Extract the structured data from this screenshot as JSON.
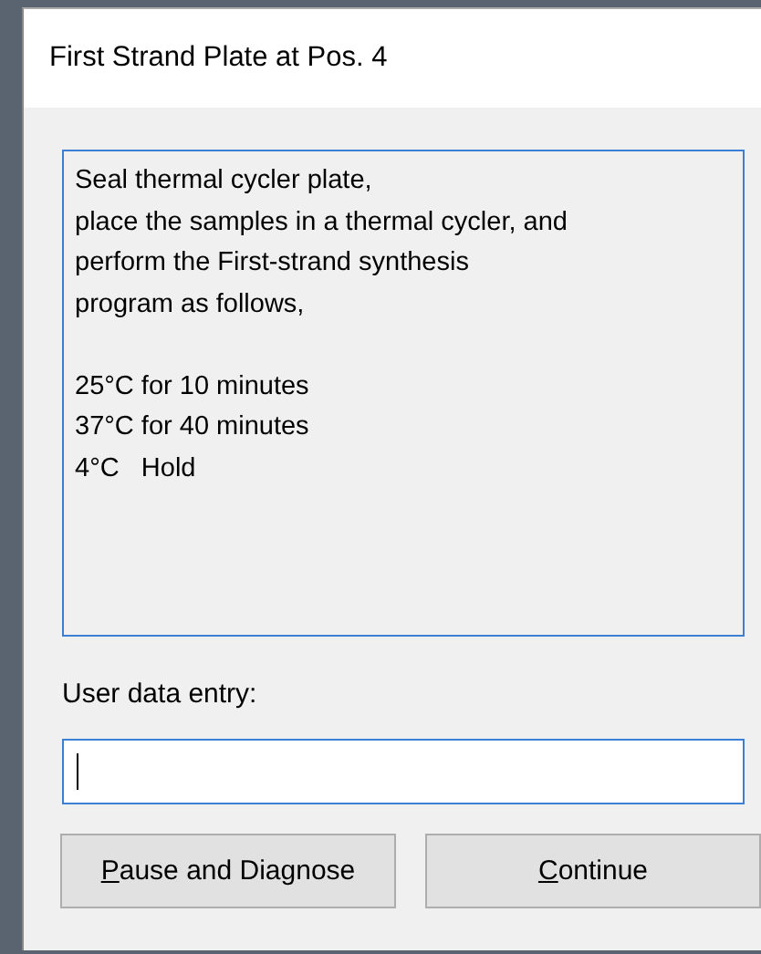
{
  "window": {
    "title": "First Strand Plate at Pos. 4"
  },
  "message": "Seal thermal cycler plate,\nplace the samples in a thermal cycler, and\nperform the First-strand synthesis\nprogram as follows,\n\n25°C for 10 minutes\n37°C for 40 minutes\n4°C   Hold",
  "entry": {
    "label": "User data entry:",
    "focused": true
  },
  "buttons": [
    {
      "label": "Pause and Diagnose"
    },
    {
      "label": "Continue"
    }
  ]
}
